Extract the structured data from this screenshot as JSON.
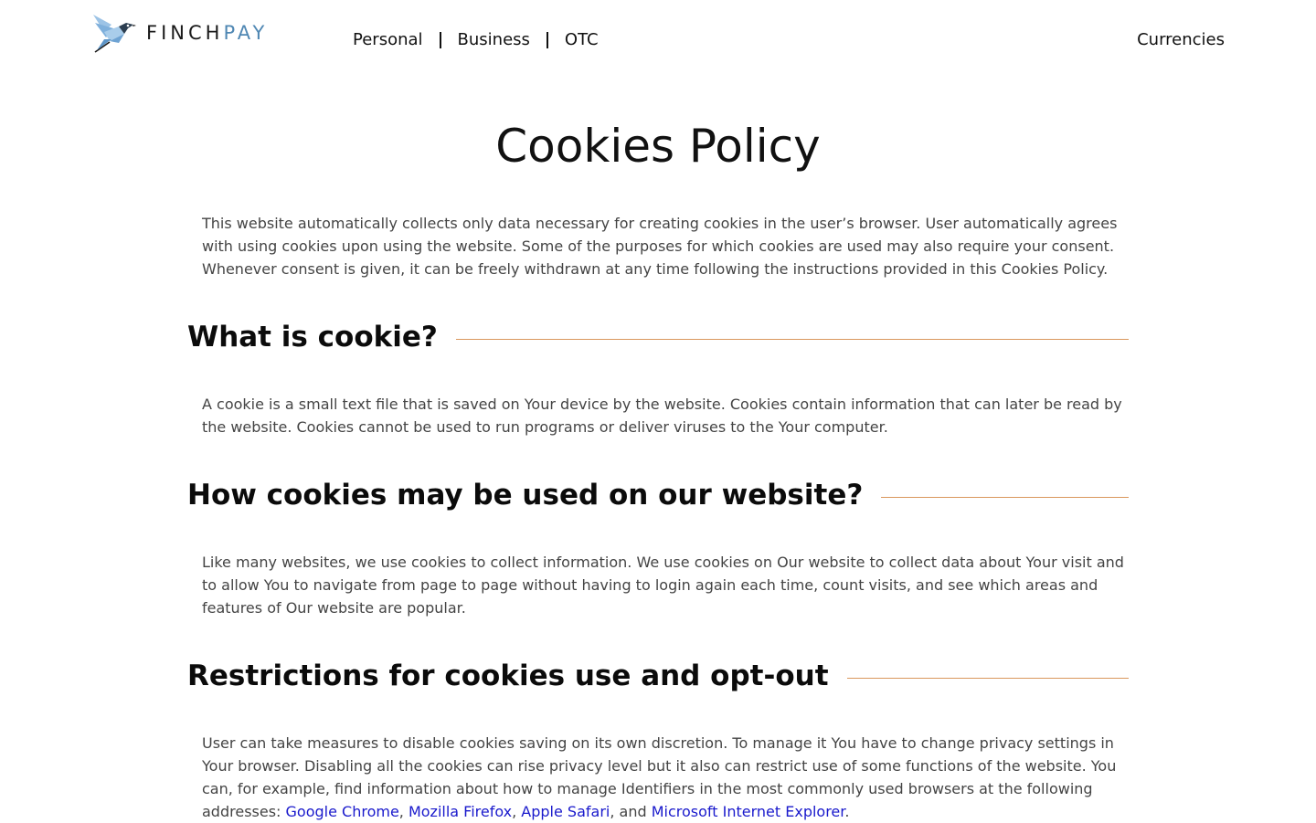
{
  "header": {
    "logo": {
      "text_a": "FINCH",
      "text_b": "PAY",
      "icon": "finch-bird-icon",
      "colors": {
        "dark": "#1a1a1a",
        "accent": "#4f87b3",
        "bird_light": "#9cc3e6"
      }
    },
    "nav": [
      {
        "label": "Personal"
      },
      {
        "label": "Business"
      },
      {
        "label": "OTC"
      }
    ],
    "nav_right": {
      "label": "Currencies"
    }
  },
  "page": {
    "title": "Cookies Policy",
    "intro": "This website automatically collects only data necessary for creating cookies in the user’s browser. User automatically agrees with using cookies upon using the website. Some of the purposes for which cookies are used may also require your consent. Whenever consent is given, it can be freely withdrawn at any time following the instructions provided in this Cookies Policy.",
    "sections": [
      {
        "heading": "What is cookie?",
        "body": "A cookie is a small text file that is saved on Your device by the website. Cookies contain information that can later be read by the website. Cookies cannot be used to run programs or deliver viruses to the Your computer."
      },
      {
        "heading": "How cookies may be used on our website?",
        "body": "Like many websites, we use cookies to collect information. We use cookies on Our website to collect data about Your visit and to allow You to navigate from page to page without having to login again each time, count visits, and see which areas and features of Our website are popular."
      },
      {
        "heading": "Restrictions for cookies use and opt-out",
        "body_start": "User can take measures to disable cookies saving on its own discretion. To manage it You have to change privacy settings in Your browser. Disabling all the cookies can rise privacy level but it also can restrict use of some functions of the website. You can, for example, find information about how to manage Identifiers in the most commonly used browsers at the following addresses: ",
        "links": [
          "Google Chrome",
          "Mozilla Firefox",
          "Apple Safari",
          "Microsoft Internet Explorer"
        ],
        "sep_comma": ", ",
        "sep_and": ", and ",
        "end": "."
      }
    ]
  },
  "colors": {
    "section_rule": "#d9975c",
    "link": "#1a1acc",
    "body_text": "#444444"
  }
}
